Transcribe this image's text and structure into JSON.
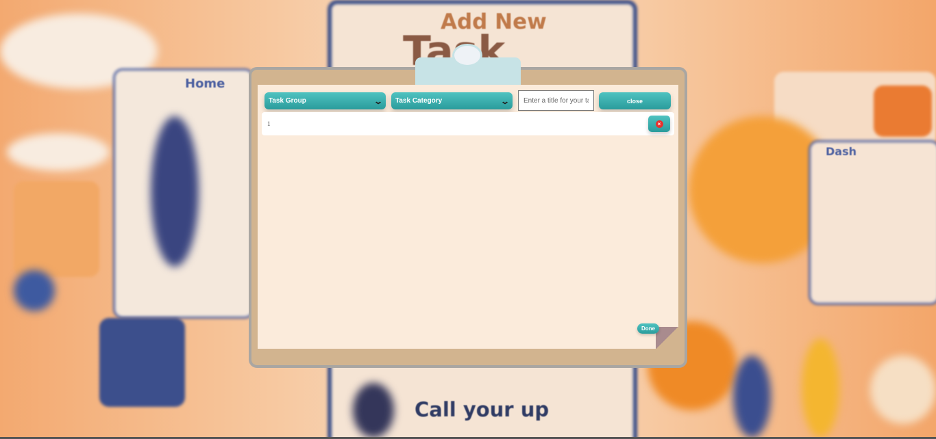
{
  "background": {
    "headline": "Add New",
    "headline_partial": "Task",
    "footer_text": "Call your up",
    "left_card_title": "Home",
    "right_card_title": "Dash"
  },
  "toolbar": {
    "task_group_label": "Task Group",
    "task_category_label": "Task Category",
    "title_input": {
      "value": "",
      "placeholder": "Enter a title for your task"
    },
    "close_label": "close",
    "dropdown_icon": "chevron-down-icon"
  },
  "tasks": [
    {
      "number": "1",
      "delete_icon": "close-circle-icon"
    }
  ],
  "done_label": "Done",
  "colors": {
    "accent": "#35aeae",
    "board": "#d2b48f",
    "paper": "#fbebdb",
    "delete": "#e8312e"
  }
}
